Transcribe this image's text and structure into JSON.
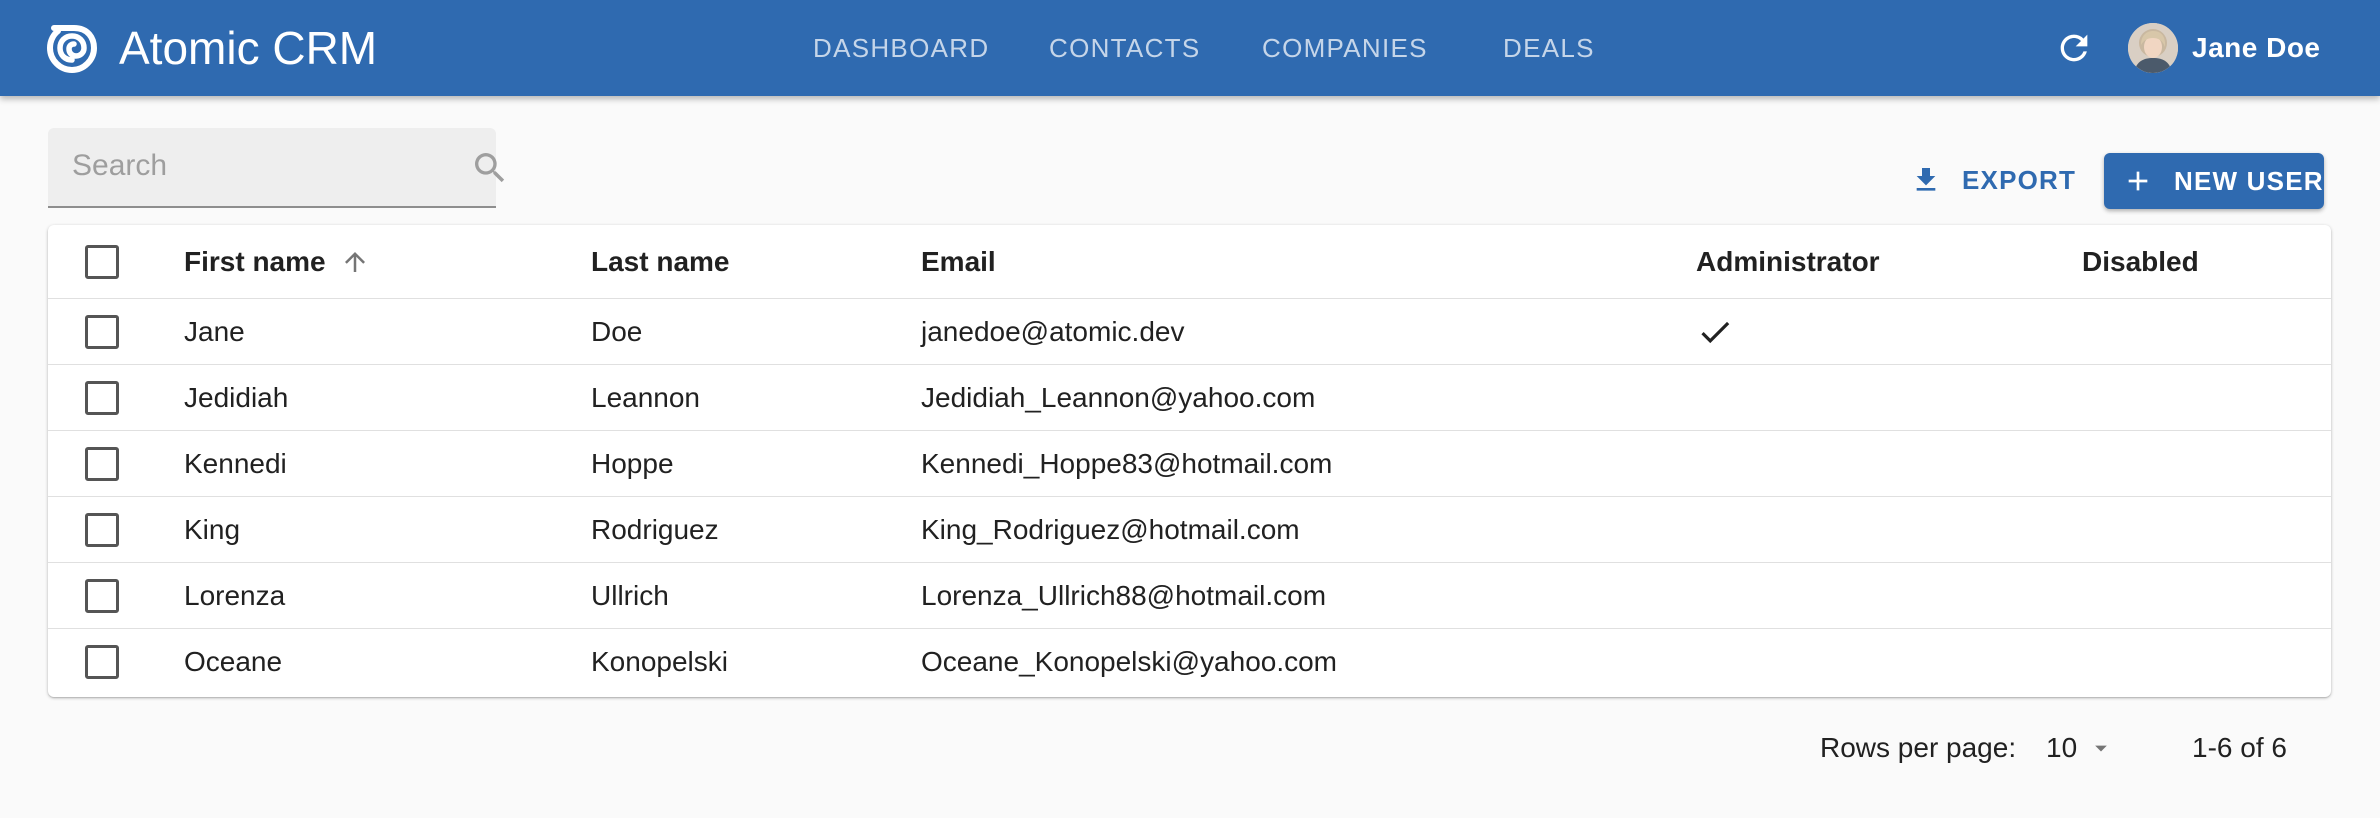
{
  "app": {
    "title": "Atomic CRM",
    "accent_color": "#2f6ab0",
    "logo_icon": "swirl-logo"
  },
  "nav": {
    "tabs": [
      {
        "label": "DASHBOARD"
      },
      {
        "label": "CONTACTS"
      },
      {
        "label": "COMPANIES"
      },
      {
        "label": "DEALS"
      }
    ]
  },
  "user": {
    "name": "Jane Doe",
    "refresh_icon": "refresh-icon"
  },
  "toolbar": {
    "search_placeholder": "Search",
    "search_value": "",
    "export_label": "EXPORT",
    "new_user_label": "NEW USER"
  },
  "table": {
    "columns": {
      "first_name": "First name",
      "last_name": "Last name",
      "email": "Email",
      "administrator": "Administrator",
      "disabled": "Disabled"
    },
    "sort": {
      "column": "first_name",
      "direction": "asc"
    },
    "rows": [
      {
        "first_name": "Jane",
        "last_name": "Doe",
        "email": "janedoe@atomic.dev",
        "administrator": true,
        "disabled": false
      },
      {
        "first_name": "Jedidiah",
        "last_name": "Leannon",
        "email": "Jedidiah_Leannon@yahoo.com",
        "administrator": false,
        "disabled": false
      },
      {
        "first_name": "Kennedi",
        "last_name": "Hoppe",
        "email": "Kennedi_Hoppe83@hotmail.com",
        "administrator": false,
        "disabled": false
      },
      {
        "first_name": "King",
        "last_name": "Rodriguez",
        "email": "King_Rodriguez@hotmail.com",
        "administrator": false,
        "disabled": false
      },
      {
        "first_name": "Lorenza",
        "last_name": "Ullrich",
        "email": "Lorenza_Ullrich88@hotmail.com",
        "administrator": false,
        "disabled": false
      },
      {
        "first_name": "Oceane",
        "last_name": "Konopelski",
        "email": "Oceane_Konopelski@yahoo.com",
        "administrator": false,
        "disabled": false
      }
    ]
  },
  "pagination": {
    "rows_per_page_label": "Rows per page:",
    "rows_per_page": "10",
    "range": "1-6 of 6"
  }
}
